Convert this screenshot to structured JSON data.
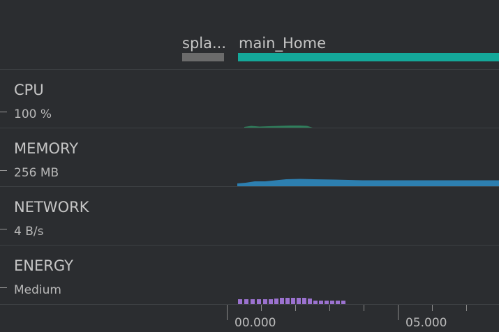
{
  "activities": [
    {
      "label": "spla...",
      "color": "#6b6b6b"
    },
    {
      "label": "main_Home",
      "color": "#14a89a"
    }
  ],
  "monitors": [
    {
      "title": "CPU",
      "scale": "100 %",
      "color": "#2f7f5c"
    },
    {
      "title": "MEMORY",
      "scale": "256 MB",
      "color": "#2d7fb0"
    },
    {
      "title": "NETWORK",
      "scale": "4 B/s",
      "color": "#3a6ea5"
    },
    {
      "title": "ENERGY",
      "scale": "Medium",
      "color": "#9b72cf"
    }
  ],
  "timeline": {
    "labels": [
      "00.000",
      "05.000"
    ]
  }
}
